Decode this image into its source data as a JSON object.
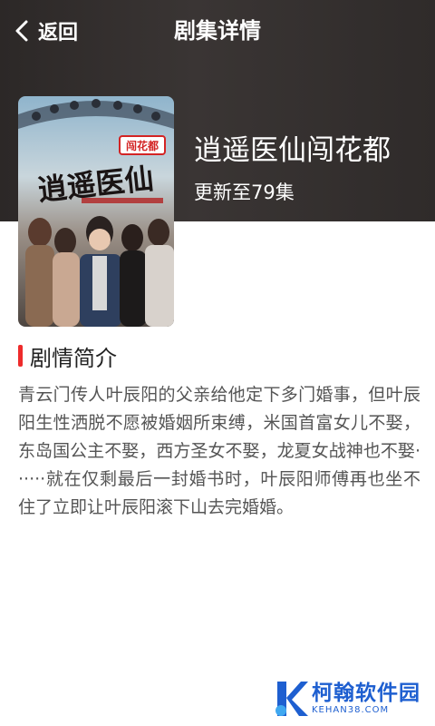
{
  "topbar": {
    "back_label": "返回",
    "title": "剧集详情"
  },
  "show": {
    "title": "逍遥医仙闯花都",
    "status": "更新至79集",
    "poster": {
      "badge": "闯花都",
      "calligraphy": "逍遥医仙"
    }
  },
  "synopsis": {
    "heading": "剧情简介",
    "body": "青云门传人叶辰阳的父亲给他定下多门婚事，但叶辰阳生性洒脱不愿被婚姻所束缚，米国首富女儿不娶，东岛国公主不娶，西方圣女不娶，龙夏女战神也不娶······就在仅剩最后一封婚书时，叶辰阳师傅再也坐不住了立即让叶辰阳滚下山去完婚婚。"
  },
  "watermark": {
    "name": "柯翰软件园",
    "url": "KEHAN38.COM"
  },
  "colors": {
    "header_bg": "#2c2827",
    "accent_red": "#ee2b2b",
    "watermark_blue": "#1e5fd0"
  }
}
